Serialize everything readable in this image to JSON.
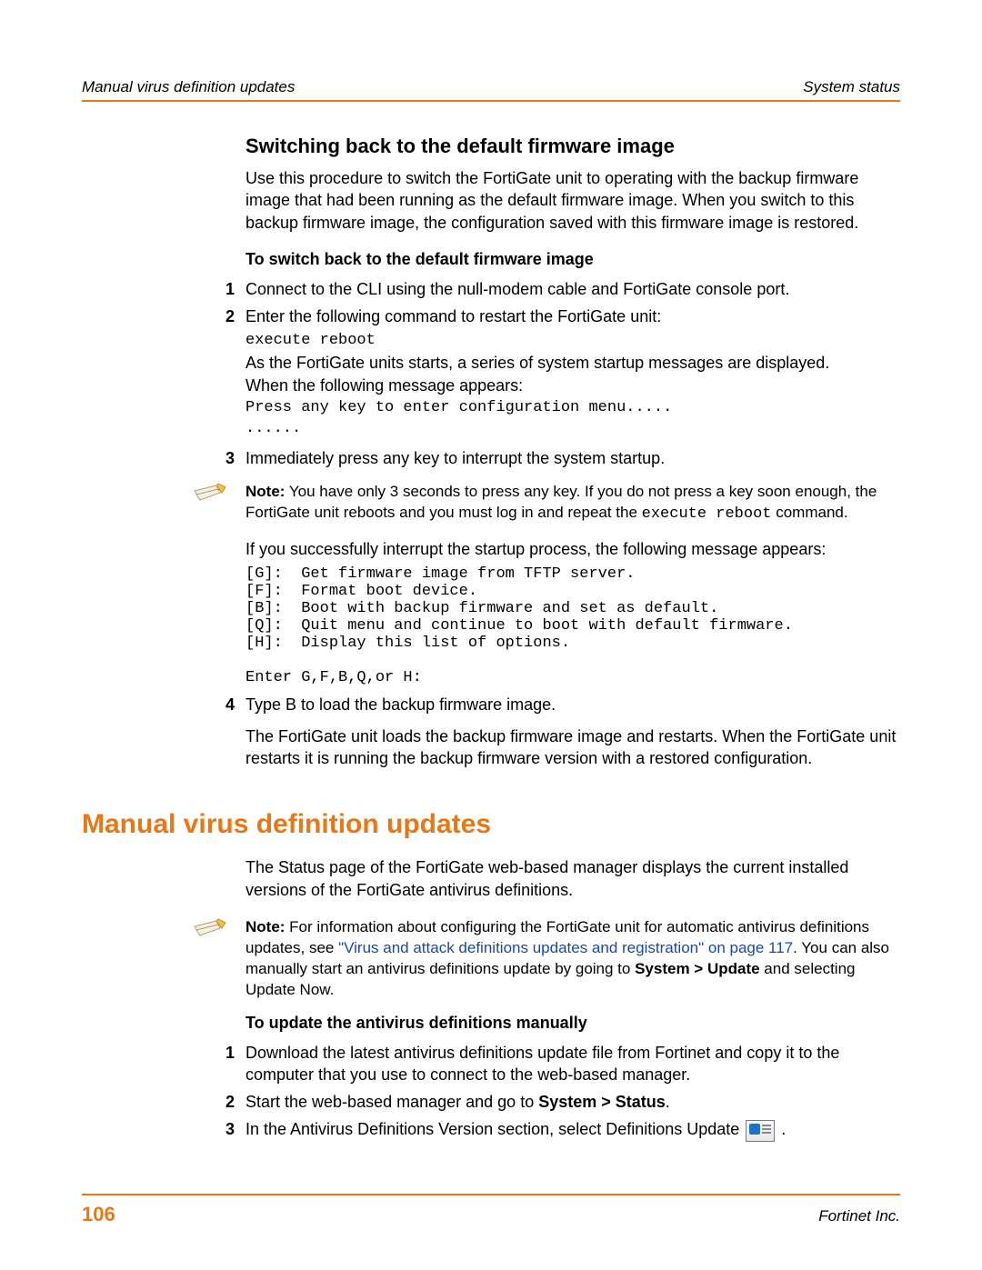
{
  "header": {
    "left": "Manual virus definition updates",
    "right": "System status"
  },
  "sec1": {
    "title": "Switching back to the default firmware image",
    "intro": "Use this procedure to switch the FortiGate unit to operating with the backup firmware image that had been running as the default firmware image. When you switch to this backup firmware image, the configuration saved with this firmware image is restored.",
    "subhead": "To switch back to the default firmware image",
    "step1_num": "1",
    "step1": "Connect to the CLI using the null-modem cable and FortiGate console port.",
    "step2_num": "2",
    "step2": "Enter the following command to restart the FortiGate unit:",
    "step2_cmd": "execute reboot",
    "step2_after1": "As the FortiGate units starts, a series of system startup messages are displayed.",
    "step2_after2": "When the following message appears:",
    "step2_msg": "Press any key to enter configuration menu.....\n......",
    "step3_num": "3",
    "step3": "Immediately press any key to interrupt the system startup.",
    "note1_label": "Note:",
    "note1_pre": " You have only 3 seconds to press any key. If you do not press a key soon enough, the FortiGate unit reboots and you must log in and repeat the ",
    "note1_code": "execute reboot",
    "note1_post": " command.",
    "after_note": "If you successfully interrupt the startup process, the following message appears:",
    "menu": "[G]:  Get firmware image from TFTP server.\n[F]:  Format boot device.\n[B]:  Boot with backup firmware and set as default.\n[Q]:  Quit menu and continue to boot with default firmware.\n[H]:  Display this list of options.\n\nEnter G,F,B,Q,or H:",
    "step4_num": "4",
    "step4": "Type B to load the backup firmware image.",
    "step4_after": "The FortiGate unit loads the backup firmware image and restarts. When the FortiGate unit restarts it is running the backup firmware version with a restored configuration."
  },
  "sec2": {
    "chapter": "Manual virus definition updates",
    "intro": "The Status page of the FortiGate web-based manager displays the current installed versions of the FortiGate antivirus definitions.",
    "note_label": "Note:",
    "note_pre": " For information about configuring the FortiGate unit for automatic antivirus definitions updates, see ",
    "note_link": "\"Virus and attack definitions updates and registration\" on page 117",
    "note_mid": ". You can also manually start an antivirus definitions update by going to ",
    "note_bold": "System > Update",
    "note_post": " and selecting Update Now.",
    "subhead": "To update the antivirus definitions manually",
    "step1_num": "1",
    "step1": "Download the latest antivirus definitions update file from Fortinet and copy it to the computer that you use to connect to the web-based manager.",
    "step2_num": "2",
    "step2_pre": "Start the web-based manager and go to ",
    "step2_bold": "System > Status",
    "step2_post": ".",
    "step3_num": "3",
    "step3_pre": "In the Antivirus Definitions Version section, select Definitions Update ",
    "step3_post": " ."
  },
  "footer": {
    "page": "106",
    "company": "Fortinet Inc."
  }
}
